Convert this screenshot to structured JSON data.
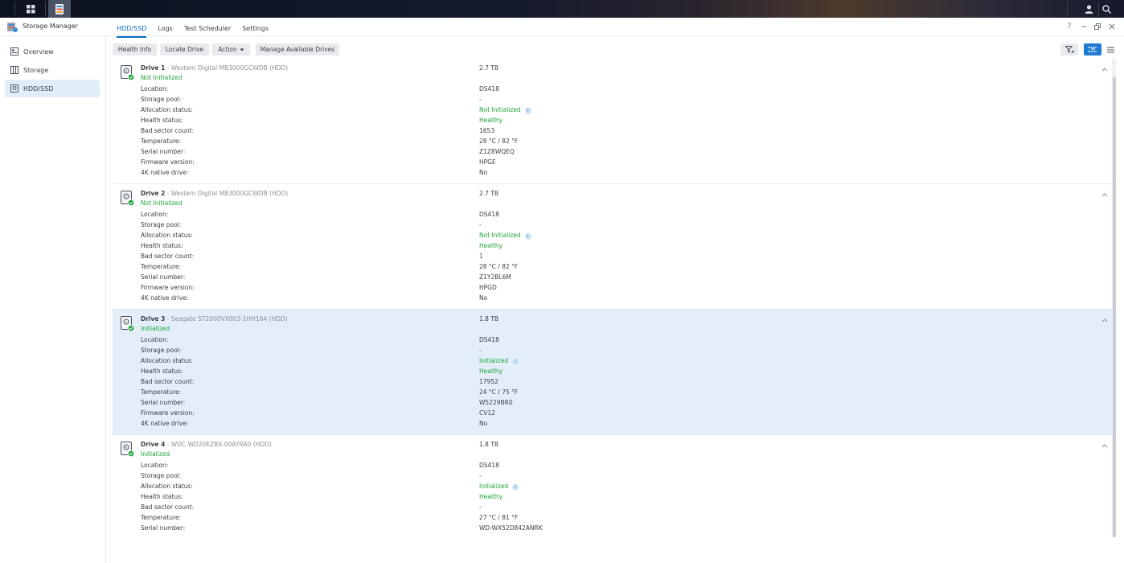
{
  "app": {
    "title": "Storage Manager"
  },
  "colors": {
    "accent": "#0b6fc4",
    "ok": "#1fa33a",
    "selected_row": "#e3eef8"
  },
  "sidebar": {
    "items": [
      {
        "label": "Overview",
        "icon": "overview-icon"
      },
      {
        "label": "Storage",
        "icon": "storage-icon"
      },
      {
        "label": "HDD/SSD",
        "icon": "hdd-icon",
        "active": true
      }
    ]
  },
  "tabs": [
    "HDD/SSD",
    "Logs",
    "Test Scheduler",
    "Settings"
  ],
  "toolbar": {
    "health_info": "Health Info",
    "locate_drive": "Locate Drive",
    "action": "Action",
    "manage": "Manage Available Drives"
  },
  "field_labels": {
    "location": "Location:",
    "pool": "Storage pool:",
    "alloc": "Allocation status:",
    "health": "Health status:",
    "bad": "Bad sector count:",
    "temp": "Temperature:",
    "serial": "Serial number:",
    "fw": "Firmware version:",
    "k4": "4K native drive:"
  },
  "drives": [
    {
      "name": "Drive 1",
      "model": " - Western Digital MB3000GCWDB (HDD)",
      "status": "Not Initialized",
      "size": "2.7 TB",
      "location": "DS418",
      "pool": "-",
      "alloc": "Not Initialized",
      "health": "Healthy",
      "bad": "1653",
      "temp": "28 °C / 82 °F",
      "serial": "Z1Z8WQEQ",
      "fw": "HPGE",
      "k4": "No"
    },
    {
      "name": "Drive 2",
      "model": " - Western Digital MB3000GCWDB (HDD)",
      "status": "Not Initialized",
      "size": "2.7 TB",
      "location": "DS418",
      "pool": "-",
      "alloc": "Not Initialized",
      "health": "Healthy",
      "bad": "1",
      "temp": "28 °C / 82 °F",
      "serial": "Z1Y2BL6M",
      "fw": "HPGD",
      "k4": "No"
    },
    {
      "name": "Drive 3",
      "model": " - Seagate ST2000VX003-1HH164 (HDD)",
      "status": "Initialized",
      "size": "1.8 TB",
      "location": "DS418",
      "pool": "-",
      "alloc": "Initialized",
      "health": "Healthy",
      "bad": "17952",
      "temp": "24 °C / 75 °F",
      "serial": "W5229BR0",
      "fw": "CV12",
      "k4": "No"
    },
    {
      "name": "Drive 4",
      "model": " - WDC WD20EZBX-00AYRA0 (HDD)",
      "status": "Initialized",
      "size": "1.8 TB",
      "location": "DS418",
      "pool": "-",
      "alloc": "Initialized",
      "health": "Healthy",
      "bad": "-",
      "temp": "27 °C / 81 °F",
      "serial": "WD-WX52D842ANRK",
      "fw": "",
      "k4": ""
    }
  ]
}
